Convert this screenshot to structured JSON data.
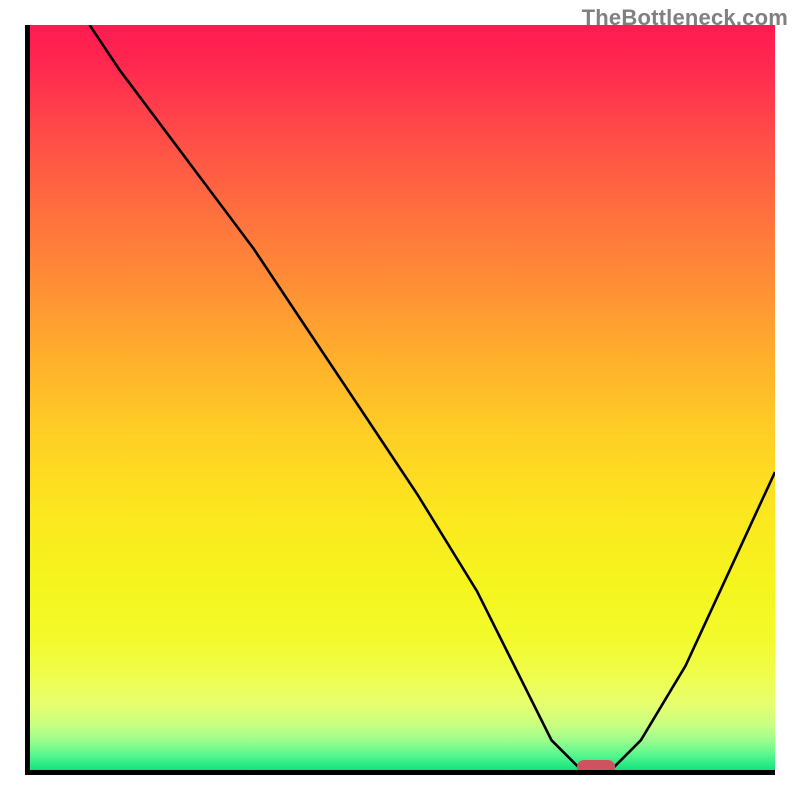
{
  "watermark": "TheBottleneck.com",
  "chart_data": {
    "type": "line",
    "title": "",
    "xlabel": "",
    "ylabel": "",
    "xlim": [
      0,
      100
    ],
    "ylim": [
      0,
      100
    ],
    "gradient_direction": "top-to-bottom",
    "gradient_stops": [
      {
        "pos": 0,
        "color": "#ff1a52"
      },
      {
        "pos": 15,
        "color": "#ff4d48"
      },
      {
        "pos": 35,
        "color": "#ff8f35"
      },
      {
        "pos": 55,
        "color": "#ffcf25"
      },
      {
        "pos": 75,
        "color": "#f5f51e"
      },
      {
        "pos": 91,
        "color": "#e8ff6e"
      },
      {
        "pos": 100,
        "color": "#14e27e"
      }
    ],
    "series": [
      {
        "name": "bottleneck-curve",
        "x": [
          8,
          12,
          18,
          24,
          30,
          36,
          44,
          52,
          60,
          66,
          70,
          74,
          78,
          82,
          88,
          94,
          100
        ],
        "y": [
          100,
          94,
          86,
          78,
          70,
          61,
          49,
          37,
          24,
          12,
          4,
          0,
          0,
          4,
          14,
          27,
          40
        ]
      }
    ],
    "marker": {
      "x": 76,
      "y": 0,
      "color": "#cf5261"
    },
    "axes": {
      "left": true,
      "bottom": true,
      "color": "#000000"
    }
  }
}
